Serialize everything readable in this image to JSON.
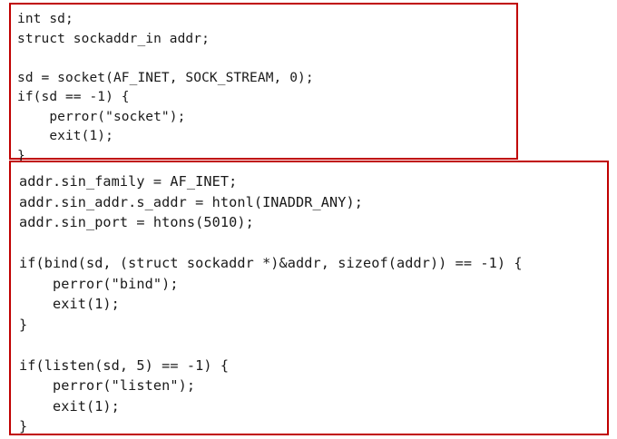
{
  "colors": {
    "border": "#c00000",
    "text": "#1a1a1a",
    "background": "#ffffff"
  },
  "block1": {
    "lines": [
      "int sd;",
      "struct sockaddr_in addr;",
      "",
      "sd = socket(AF_INET, SOCK_STREAM, 0);",
      "if(sd == -1) {",
      "    perror(\"socket\");",
      "    exit(1);",
      "}"
    ]
  },
  "block2": {
    "lines": [
      "addr.sin_family = AF_INET;",
      "addr.sin_addr.s_addr = htonl(INADDR_ANY);",
      "addr.sin_port = htons(5010);",
      "",
      "if(bind(sd, (struct sockaddr *)&addr, sizeof(addr)) == -1) {",
      "    perror(\"bind\");",
      "    exit(1);",
      "}",
      "",
      "if(listen(sd, 5) == -1) {",
      "    perror(\"listen\");",
      "    exit(1);",
      "}"
    ]
  }
}
